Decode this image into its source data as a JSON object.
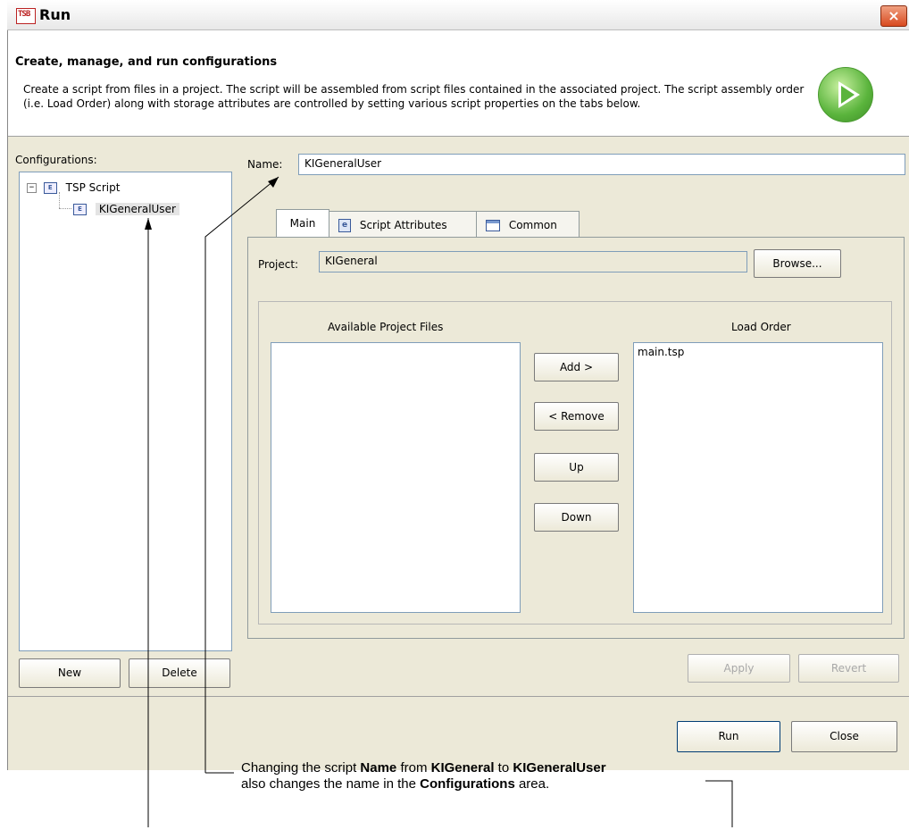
{
  "window": {
    "title": "Run",
    "app_icon_text": "TSB",
    "close_icon": "×"
  },
  "header": {
    "title": "Create, manage, and run configurations",
    "description": "Create a script from files in a project.  The script will be assembled from script files contained in the associated project. The script assembly order (i.e. Load Order) along with storage attributes are controlled by setting various script properties on the tabs below.",
    "icon": "run-play-icon"
  },
  "configurations": {
    "label": "Configurations:",
    "tree": [
      {
        "label": "TSP Script",
        "expander": "−",
        "icon_text": "E"
      },
      {
        "label": "KIGeneralUser",
        "icon_text": "E",
        "selected": true
      }
    ],
    "new_label": "New",
    "delete_label": "Delete"
  },
  "name_field": {
    "label": "Name:",
    "value": "KIGeneralUser"
  },
  "tabs": [
    {
      "label": "Main",
      "active": true
    },
    {
      "label": "Script Attributes"
    },
    {
      "label": "Common"
    }
  ],
  "main_tab": {
    "project_label": "Project:",
    "project_value": "KIGeneral",
    "browse_label": "Browse...",
    "available_label": "Available Project Files",
    "load_order_label": "Load Order",
    "load_order_items": [
      "main.tsp"
    ],
    "add_label": "Add >",
    "remove_label": "< Remove",
    "up_label": "Up",
    "down_label": "Down"
  },
  "actions": {
    "apply_label": "Apply",
    "revert_label": "Revert",
    "run_label": "Run",
    "close_label": "Close"
  },
  "annotation": {
    "t1": "Changing the script ",
    "b1": "Name",
    "t2": " from ",
    "b2": "KIGeneral",
    "t3": " to ",
    "b3": "KIGeneralUser",
    "t4": "also changes the name in the ",
    "b4": "Configurations",
    "t5": " area."
  }
}
